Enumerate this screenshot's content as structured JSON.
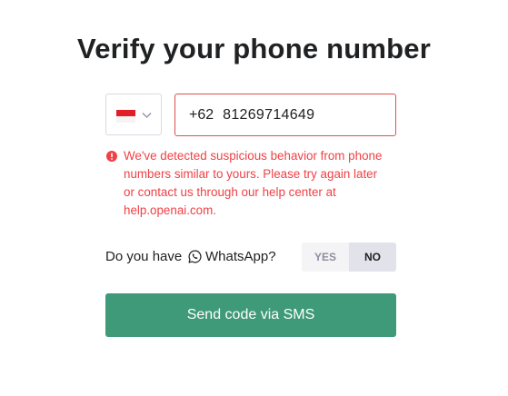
{
  "page": {
    "title": "Verify your phone number"
  },
  "phone": {
    "country_flag": "indonesia-flag",
    "dial_code": "+62",
    "number": "81269714649"
  },
  "error": {
    "message": "We've detected suspicious behavior from phone numbers similar to yours. Please try again later or contact us through our help center at help.openai.com.",
    "color": "#ef4146"
  },
  "whatsapp": {
    "question_prefix": "Do you have",
    "question_app": "WhatsApp?",
    "yes_label": "YES",
    "no_label": "NO",
    "selected": "NO"
  },
  "submit": {
    "label": "Send code via SMS",
    "color": "#3e9a78"
  }
}
